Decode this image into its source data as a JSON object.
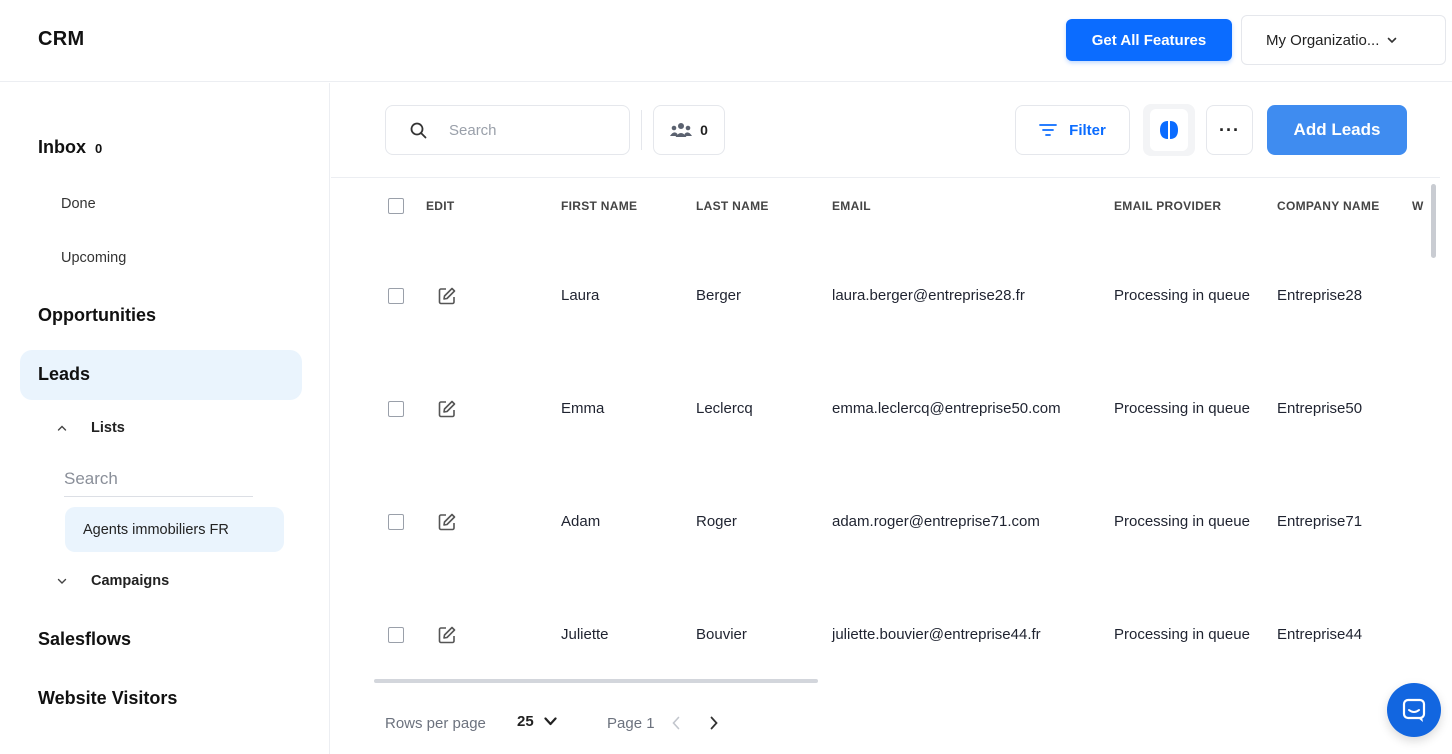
{
  "header": {
    "title": "CRM",
    "features_button": "Get All Features",
    "org_select": "My Organizatio..."
  },
  "sidebar": {
    "inbox_label": "Inbox",
    "inbox_count": "0",
    "done": "Done",
    "upcoming": "Upcoming",
    "opportunities": "Opportunities",
    "leads": "Leads",
    "lists": "Lists",
    "search_placeholder": "Search",
    "list_items": [
      "Agents immobiliers FR"
    ],
    "campaigns": "Campaigns",
    "salesflows": "Salesflows",
    "website_visitors": "Website Visitors"
  },
  "toolbar": {
    "search_placeholder": "Search",
    "people_count": "0",
    "filter_label": "Filter",
    "more_label": "···",
    "add_label": "Add Leads"
  },
  "table": {
    "columns": [
      "EDIT",
      "FIRST NAME",
      "LAST NAME",
      "EMAIL",
      "EMAIL PROVIDER",
      "COMPANY NAME",
      "W"
    ],
    "rows": [
      {
        "first": "Laura",
        "last": "Berger",
        "email": "laura.berger@entreprise28.fr",
        "provider": "Processing in queue",
        "company": "Entreprise28"
      },
      {
        "first": "Emma",
        "last": "Leclercq",
        "email": "emma.leclercq@entreprise50.com",
        "provider": "Processing in queue",
        "company": "Entreprise50"
      },
      {
        "first": "Adam",
        "last": "Roger",
        "email": "adam.roger@entreprise71.com",
        "provider": "Processing in queue",
        "company": "Entreprise71"
      },
      {
        "first": "Juliette",
        "last": "Bouvier",
        "email": "juliette.bouvier@entreprise44.fr",
        "provider": "Processing in queue",
        "company": "Entreprise44"
      }
    ]
  },
  "pagination": {
    "rows_per_page_label": "Rows per page",
    "rows_per_page": "25",
    "page_label": "Page 1"
  },
  "colors": {
    "accent": "#0b6cff",
    "add_button": "#3f8cf0",
    "selected_bg": "#eaf4fd",
    "chat_button": "#1266e0"
  },
  "icons": [
    "search-icon",
    "people-icon",
    "filter-icon",
    "brain-icon",
    "more-icon",
    "edit-icon",
    "chevron-down-icon",
    "chevron-up-icon",
    "chevron-left-icon",
    "chevron-right-icon",
    "chat-icon"
  ]
}
